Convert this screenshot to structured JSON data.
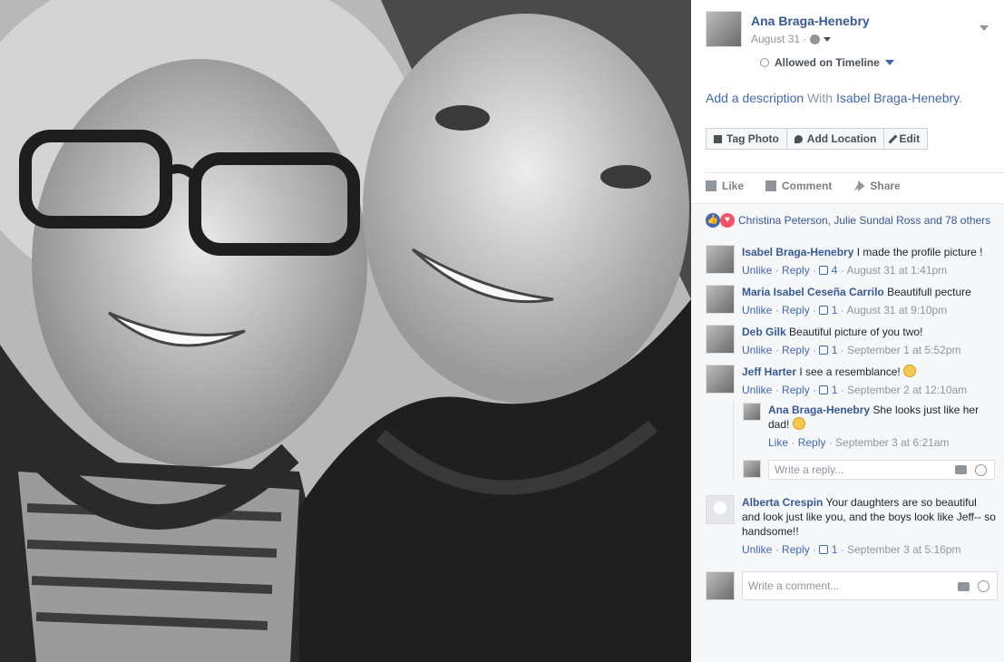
{
  "post": {
    "author": "Ana Braga-Henebry",
    "date": "August 31 · ",
    "audience_icon": "globe-icon",
    "timeline_status": "Allowed on Timeline"
  },
  "description": {
    "add_label": "Add a description",
    "with_text": " With ",
    "tagged": "Isabel Braga-Henebry",
    "end": "."
  },
  "buttons": {
    "tag_photo": "Tag Photo",
    "add_location": "Add Location",
    "edit": "Edit"
  },
  "actions": {
    "like": "Like",
    "comment": "Comment",
    "share": "Share"
  },
  "reactions": {
    "summary": "Christina Peterson, Julie Sundal Ross and 78 others"
  },
  "comments": [
    {
      "name": "Isabel Braga-Henebry",
      "text": " I made the profile picture !",
      "action": "Unlike",
      "reply": "Reply",
      "likes": "4",
      "time": "August 31 at 1:41pm"
    },
    {
      "name": "Maria Isabel Ceseña Carrilo",
      "text": " Beautifull pecture",
      "action": "Unlike",
      "reply": "Reply",
      "likes": "1",
      "time": "August 31 at 9:10pm"
    },
    {
      "name": "Deb Gilk",
      "text": " Beautiful picture of you two!",
      "action": "Unlike",
      "reply": "Reply",
      "likes": "1",
      "time": "September 1 at 5:52pm"
    },
    {
      "name": "Jeff Harter",
      "text": " I see a resemblance! ",
      "action": "Unlike",
      "reply": "Reply",
      "likes": "1",
      "time": "September 2 at 12:10am"
    },
    {
      "name": "Alberta Crespin",
      "text": " Your daughters are so beautiful and look just like you, and the boys look like Jeff-- so handsome!!",
      "action": "Unlike",
      "reply": "Reply",
      "likes": "1",
      "time": "September 3 at 5:16pm"
    }
  ],
  "reply": {
    "name": "Ana Braga-Henebry",
    "text": " She looks just like her dad! ",
    "action": "Like",
    "reply": "Reply",
    "time": "September 3 at 6:21am",
    "input_placeholder": "Write a reply..."
  },
  "comment_input": {
    "placeholder": "Write a comment..."
  },
  "sep": " · "
}
